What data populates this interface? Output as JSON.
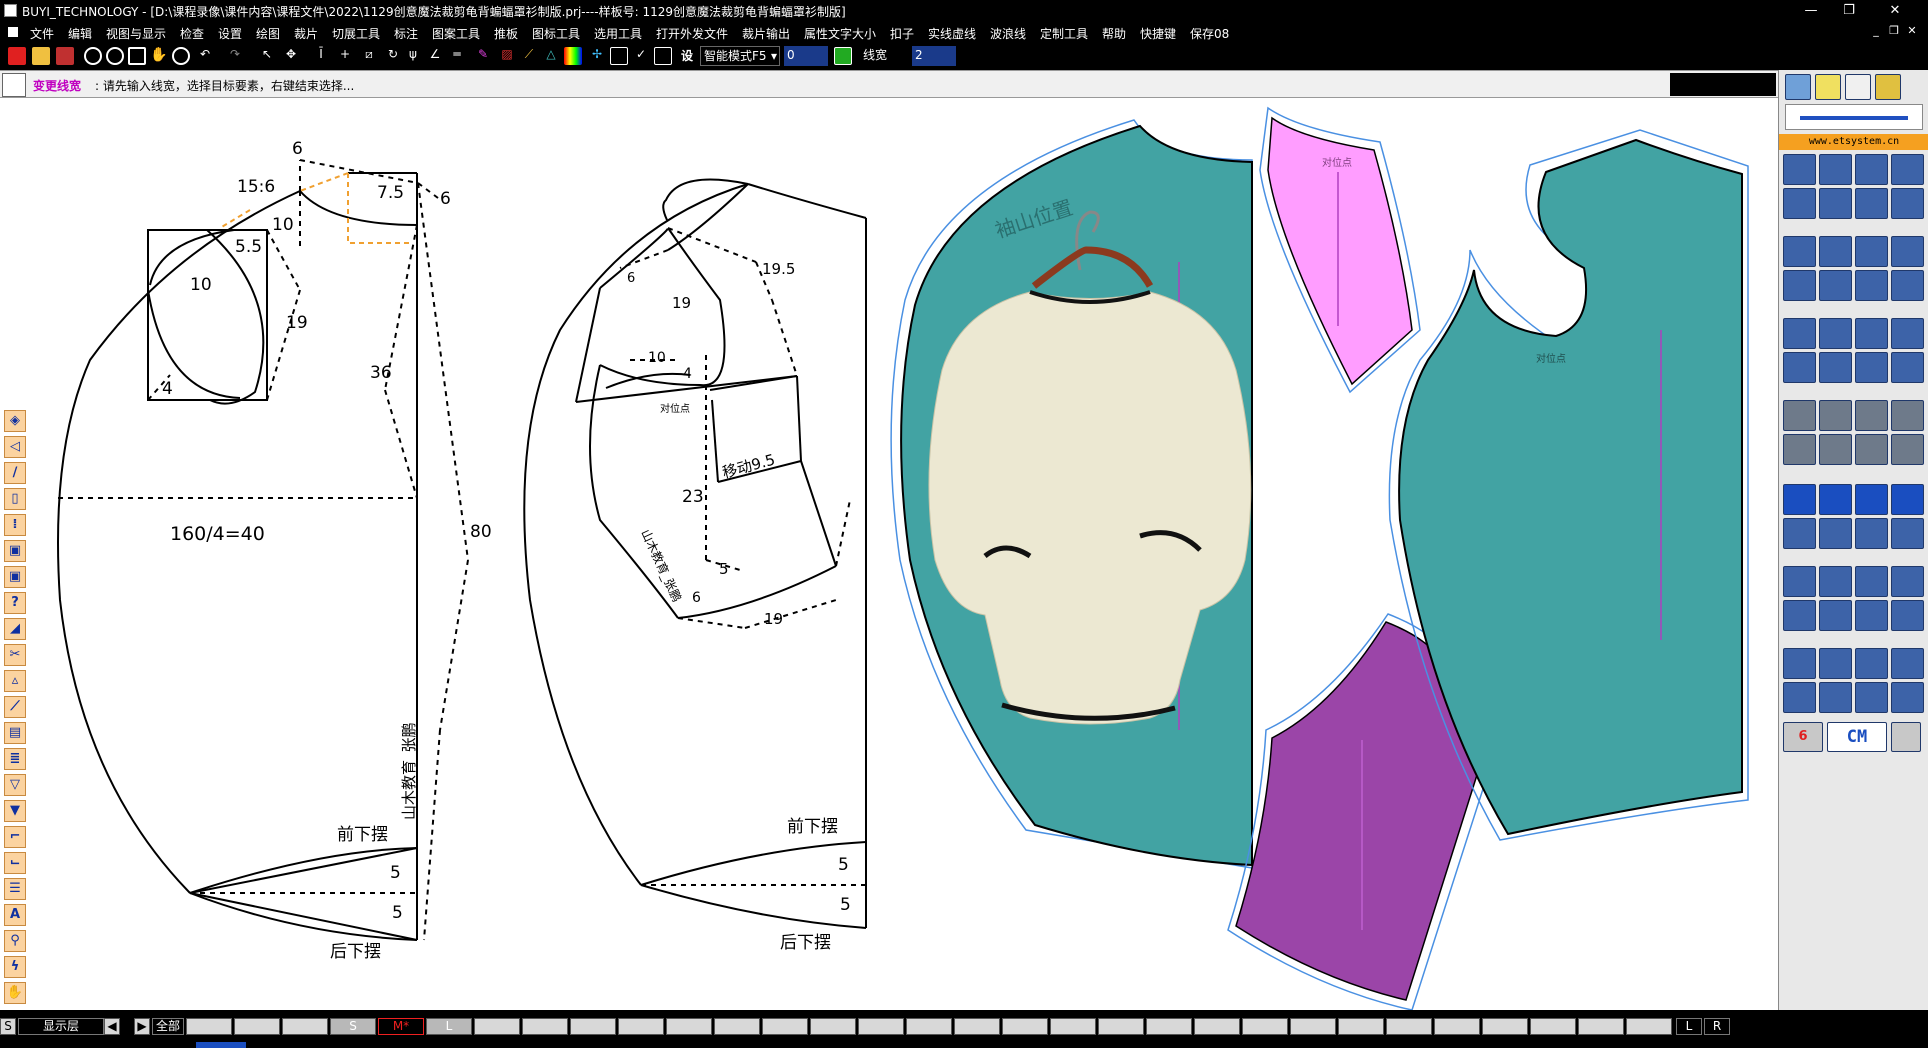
{
  "window": {
    "app": "BUYI_TECHNOLOGY",
    "title": "BUYI_TECHNOLOGY - [D:\\课程录像\\课件内容\\课程文件\\2022\\1129创意魔法裁剪龟背蝙蝠罩衫制版.prj----样板号: 1129创意魔法裁剪龟背蝙蝠罩衫制版]",
    "min": "—",
    "max": "❐",
    "close": "✕"
  },
  "menu": [
    "文件",
    "编辑",
    "视图与显示",
    "检查",
    "设置",
    "绘图",
    "裁片",
    "切展工具",
    "标注",
    "图案工具",
    "推板",
    "图标工具",
    "选用工具",
    "打开外发文件",
    "裁片输出",
    "属性文字大小",
    "扣子",
    "实线虚线",
    "波浪线",
    "定制工具",
    "帮助",
    "快捷键",
    "保存08"
  ],
  "toolbar": {
    "set_button": "设",
    "mode_select": "智能模式F5",
    "width_value": "0",
    "line_width_label": "线宽",
    "line_width_value": "2"
  },
  "prompt": {
    "command": "变更线宽",
    "message": ": 请先输入线宽，选择目标要素，右键结束选择..."
  },
  "pattern_labels": {
    "a_15_6": "15:6",
    "a_6_top": "6",
    "a_7_5": "7.5",
    "a_6_right": "6",
    "a_10_neck": "10",
    "a_5_5": "5.5",
    "a_10_inner": "10",
    "a_19": "19",
    "a_4": "4",
    "a_36": "36",
    "a_160": "160/4=40",
    "a_80": "80",
    "a_vertical": "山木教育_张鹏",
    "a_front_hem": "前下摆",
    "a_5a": "5",
    "a_5b": "5",
    "a_back_hem": "后下摆",
    "b_19_5": "19.5",
    "b_6": "6",
    "b_19": "19",
    "b_10": "10",
    "b_4": "4",
    "b_center": "对位点",
    "b_move": "移动9.5",
    "b_23": "23",
    "b_5": "5",
    "b_vertical": "山木教育_张鹏",
    "b_6_low": "6",
    "b_19_low": "19",
    "b_front_hem": "前下摆",
    "b_5a": "5",
    "b_5b": "5",
    "b_back_hem": "后下摆"
  },
  "piece_labels": {
    "sleeve_mark": "袖山位置",
    "pink_mark": "对位点",
    "right_mark": "对位点"
  },
  "website": "www.etsystem.cn",
  "unit_button": "CM",
  "unit_count": "6",
  "status": {
    "s": "S",
    "layer": "显示层",
    "prev": "◀",
    "next": "▶",
    "all": "全部",
    "slot_s": "S",
    "slot_m": "M*",
    "slot_l": "L",
    "l": "L",
    "r": "R"
  },
  "colors": {
    "teal": "#42a3a3",
    "pink": "#ff9dff",
    "purple": "#9b45a8",
    "accent": "#c000c0"
  }
}
